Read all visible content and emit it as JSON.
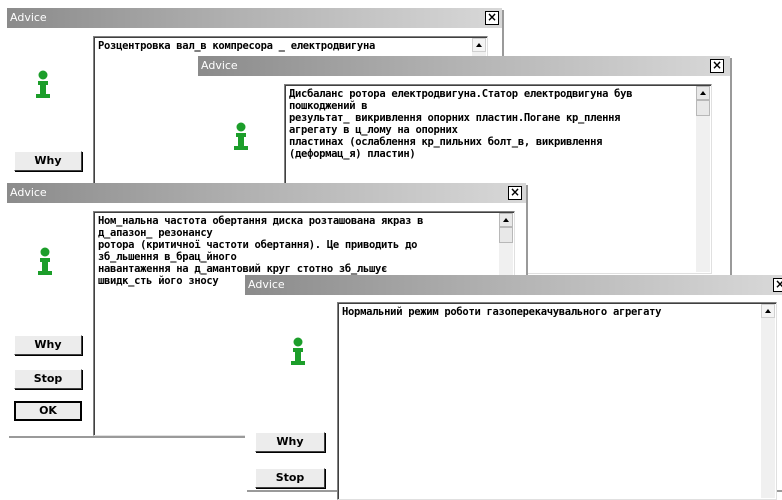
{
  "colors": {
    "titlebar_start": "#8b8b8b",
    "titlebar_end": "#d8d8d8",
    "icon_green": "#1c9e2a"
  },
  "dialogs": [
    {
      "title": "Advice",
      "close": "×",
      "message": "Розцентровка вал_в компресора _ електродвигуна",
      "buttons": {
        "why": "Why"
      }
    },
    {
      "title": "Advice",
      "close": "×",
      "message": "Дисбаланс ротора електродвигуна.Статор електродвигуна був\nпошкоджений в\nрезультат_ викривлення опорних пластин.Погане кр_плення\nагрегату в ц_лому на опорних\nпластинах (ослаблення кр_пильних болт_в, викривлення\n(деформац_я) пластин)"
    },
    {
      "title": "Advice",
      "close": "×",
      "message": "Ном_нальна частота обертання диска розташована якраз в\nд_апазон_ резонансу\nротора (критичної частоти обертання). Це приводить до\nзб_льшення в_брац_йного\nнавантаження на д_амантовий круг     стотно зб_льшує\nшвидк_сть його зносу",
      "buttons": {
        "why": "Why",
        "stop": "Stop",
        "ok": "OK"
      }
    },
    {
      "title": "Advice",
      "close": "×",
      "message": "Нормальний режим роботи газоперекачувального агрегату",
      "buttons": {
        "why": "Why",
        "stop": "Stop"
      }
    }
  ]
}
